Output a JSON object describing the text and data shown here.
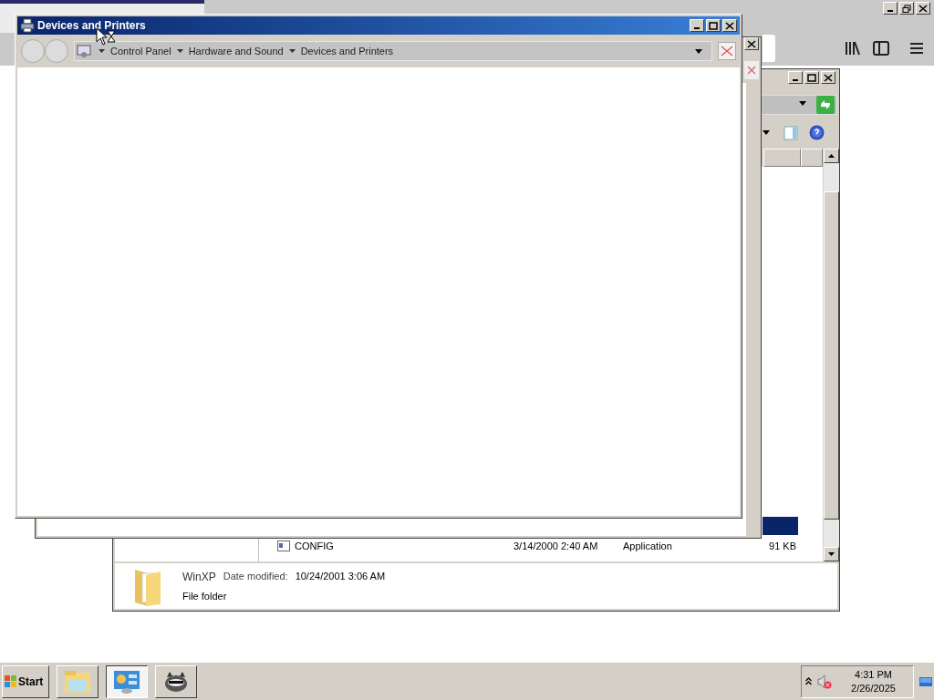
{
  "front_window": {
    "title": "Devices and Printers",
    "breadcrumb": [
      "Control Panel",
      "Hardware and Sound",
      "Devices and Printers"
    ]
  },
  "explorer": {
    "rows": [
      {
        "name": "CONFIG",
        "date": "3/14/2000 2:40 AM",
        "type": "Application",
        "size": "91 KB"
      }
    ],
    "details": {
      "name": "WinXP",
      "date_label": "Date modified:",
      "date": "10/24/2001 3:06 AM",
      "type": "File folder"
    }
  },
  "taskbar": {
    "start": "Start",
    "buttons": [
      {
        "kind": "folder",
        "selected": false
      },
      {
        "kind": "control-panel",
        "selected": true
      },
      {
        "kind": "raccoon",
        "selected": false
      }
    ],
    "time": "4:31 PM",
    "date": "2/26/2025"
  }
}
